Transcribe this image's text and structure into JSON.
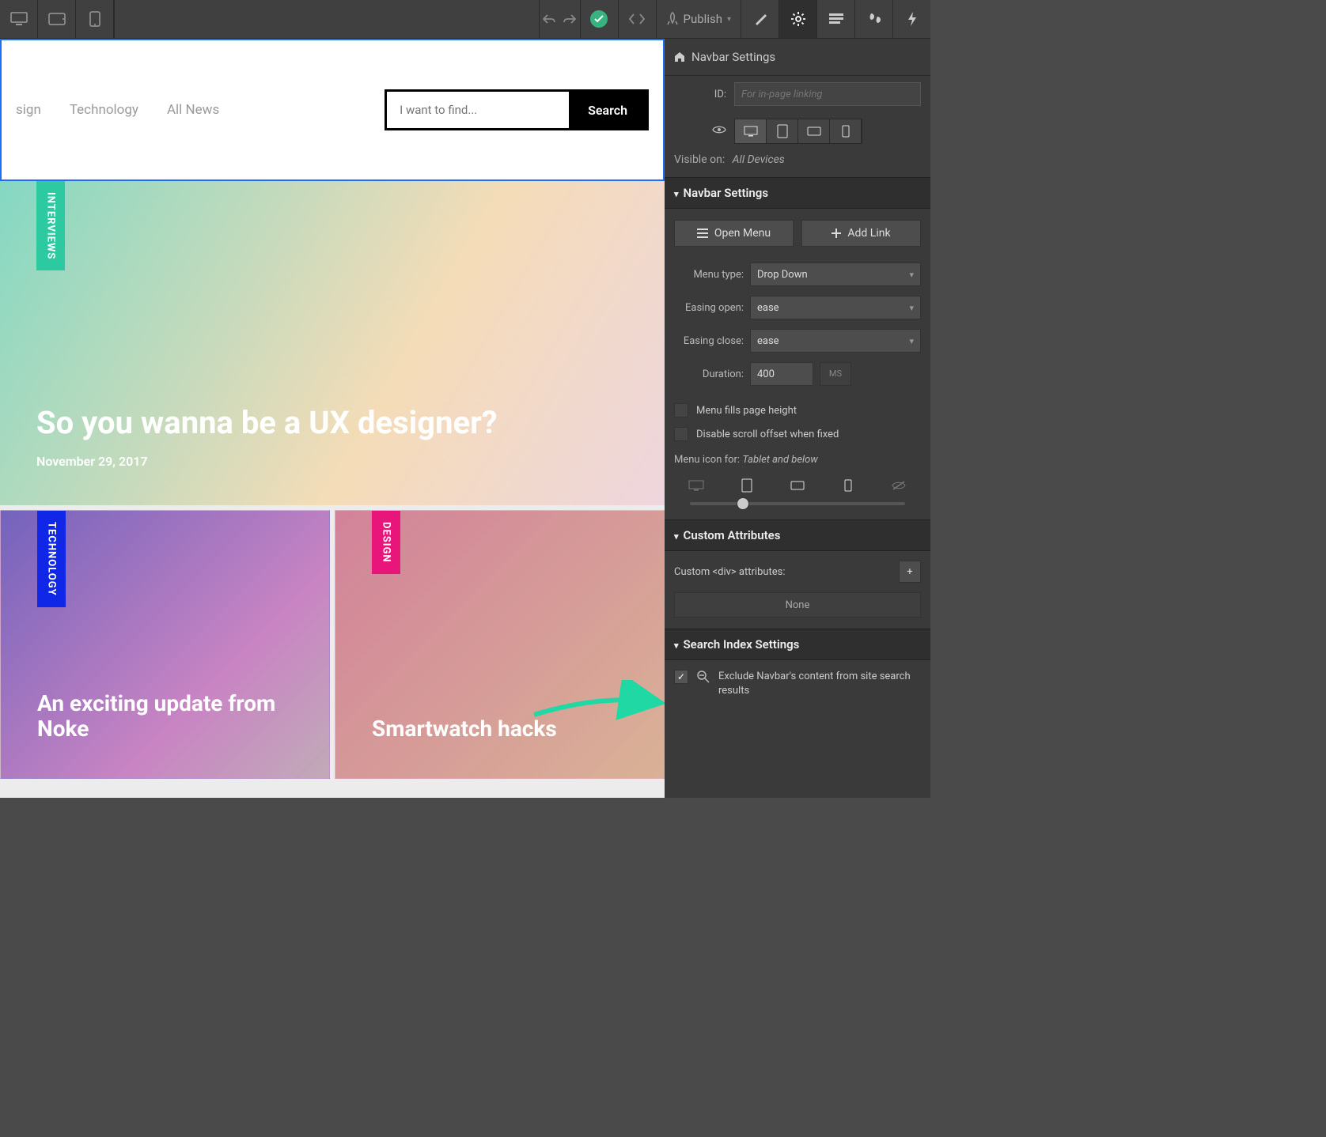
{
  "toolbar": {
    "publish_label": "Publish"
  },
  "panel": {
    "breadcrumb": "Navbar Settings",
    "id_label": "ID:",
    "id_placeholder": "For in-page linking",
    "visible_on_label": "Visible on:",
    "visible_on_value": "All Devices",
    "navbar_settings_header": "Navbar Settings",
    "open_menu_label": "Open Menu",
    "add_link_label": "Add Link",
    "menu_type_label": "Menu type:",
    "menu_type_value": "Drop Down",
    "easing_open_label": "Easing open:",
    "easing_open_value": "ease",
    "easing_close_label": "Easing close:",
    "easing_close_value": "ease",
    "duration_label": "Duration:",
    "duration_value": "400",
    "duration_unit": "MS",
    "menu_fills_label": "Menu fills page height",
    "disable_scroll_label": "Disable scroll offset when fixed",
    "menu_icon_for_label": "Menu icon for:",
    "menu_icon_for_value": "Tablet and below",
    "custom_attr_header": "Custom Attributes",
    "custom_attr_label": "Custom <div> attributes:",
    "custom_attr_none": "None",
    "search_index_header": "Search Index Settings",
    "exclude_label": "Exclude Navbar's content from site search results"
  },
  "site": {
    "nav": {
      "design": "sign",
      "technology": "Technology",
      "all_news": "All News"
    },
    "search_placeholder": "I want to find...",
    "search_button": "Search",
    "hero": {
      "tag": "INTERVIEWS",
      "title": "So you wanna be a UX designer?",
      "date": "November 29, 2017"
    },
    "card1": {
      "tag": "TECHNOLOGY",
      "title": "An exciting update from Noke"
    },
    "card2": {
      "tag": "DESIGN",
      "title": "Smartwatch hacks"
    }
  }
}
